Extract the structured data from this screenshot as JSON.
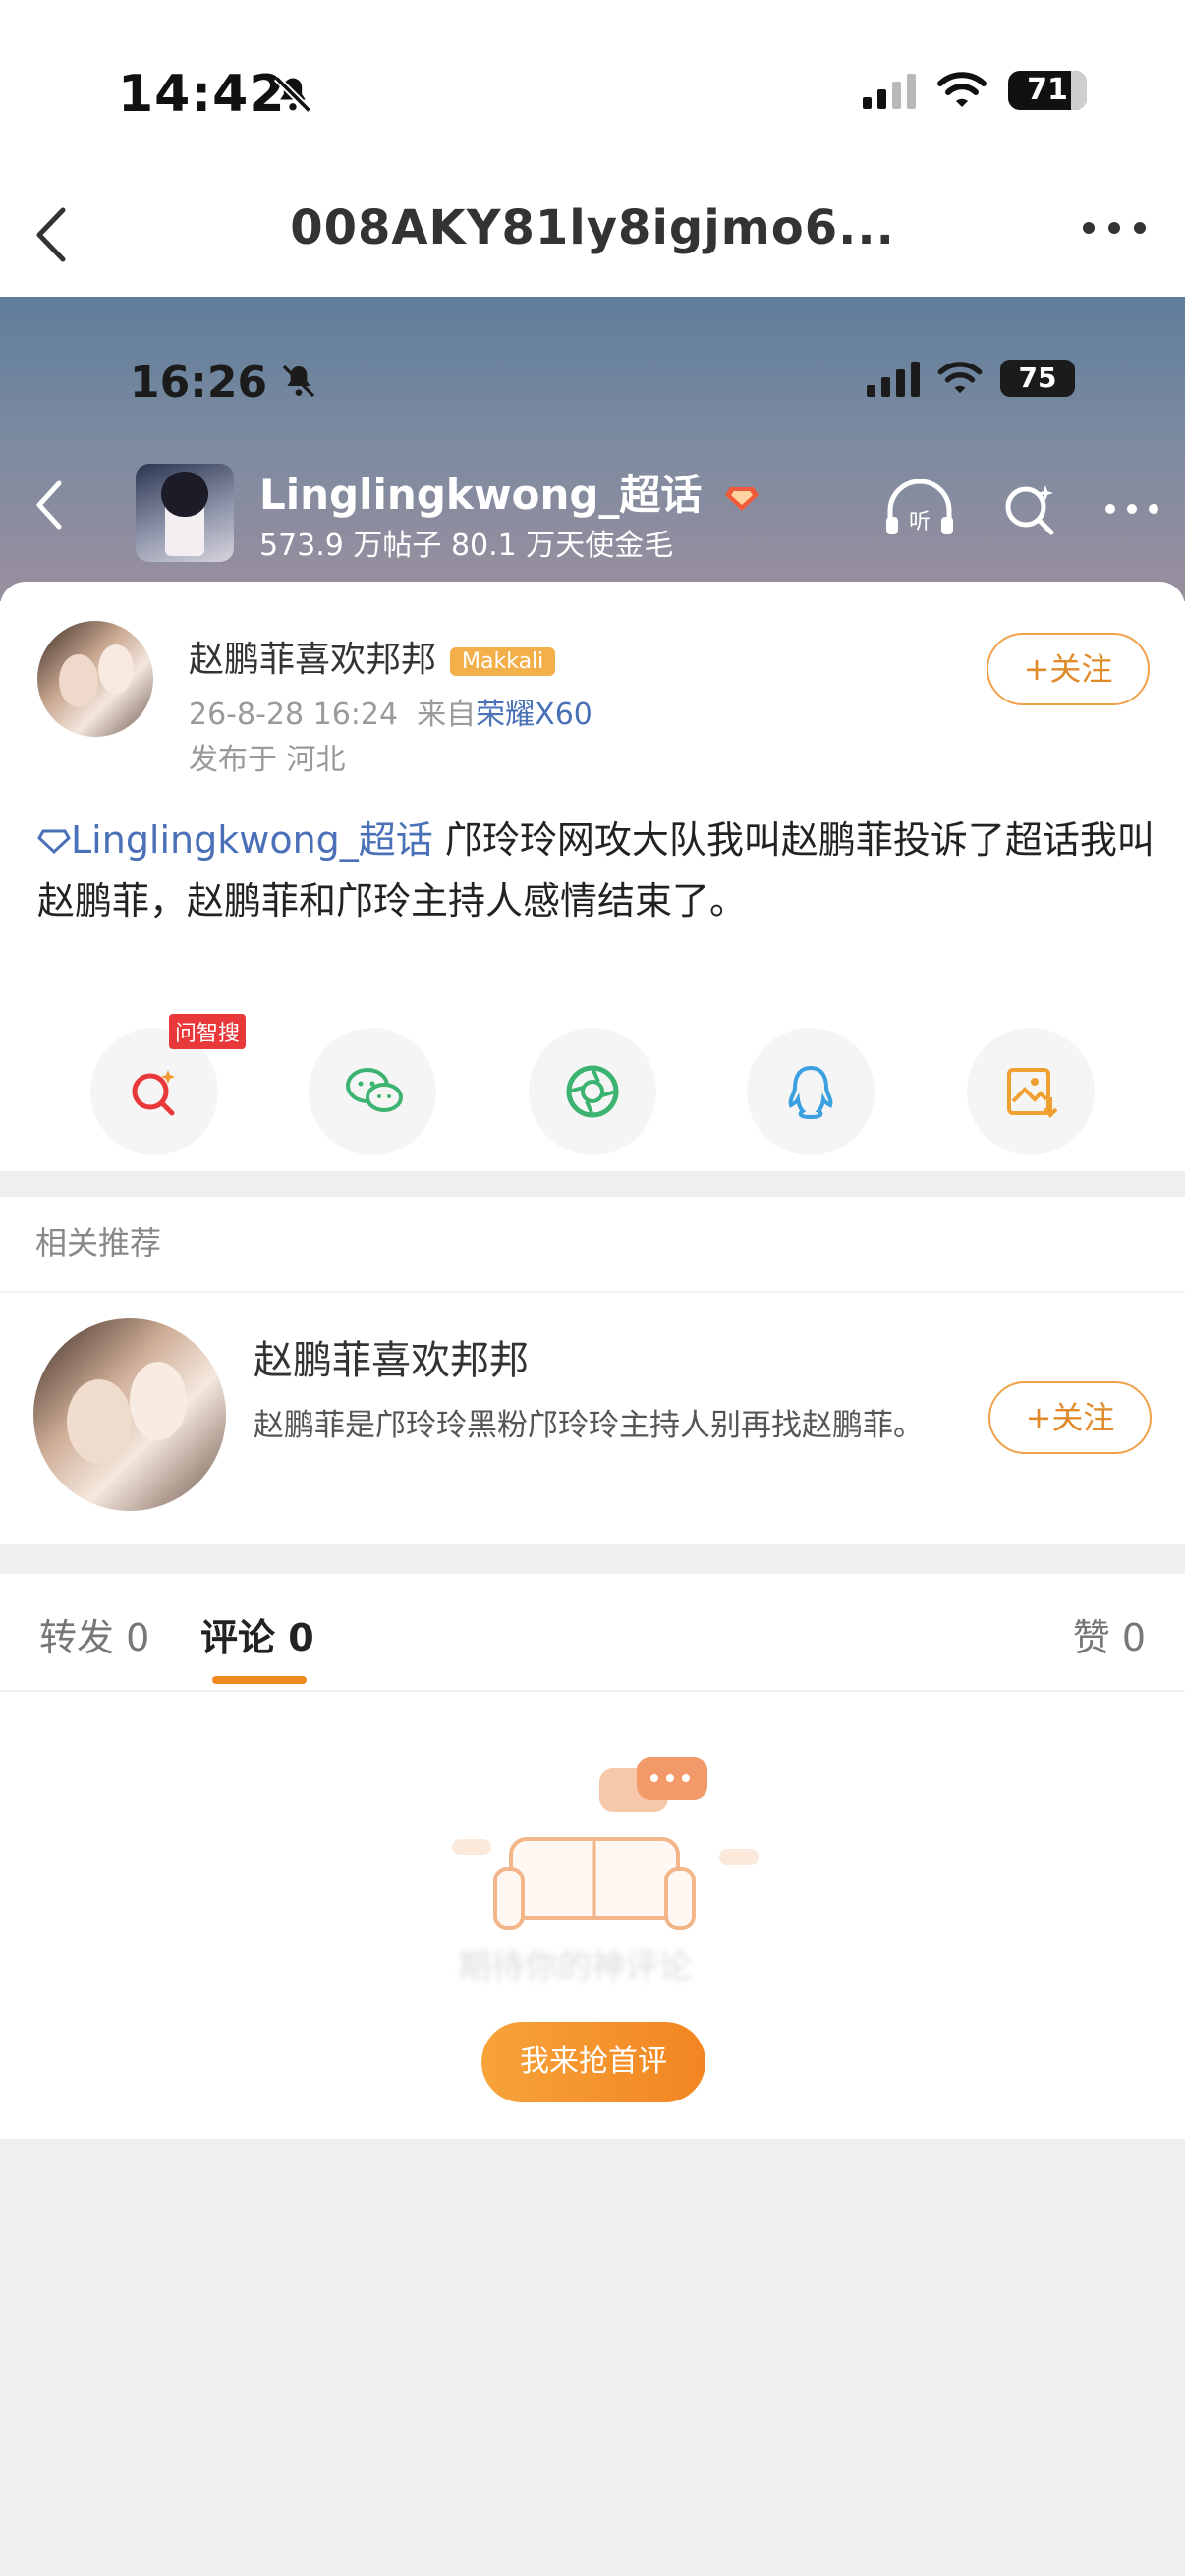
{
  "os_status": {
    "time": "14:42",
    "battery": "71"
  },
  "nav": {
    "title": "008AKY81ly8igjmo6..."
  },
  "inner": {
    "status": {
      "time": "16:26",
      "battery": "75"
    },
    "header": {
      "title": "Linglingkwong_超话",
      "stats": "573.9 万帖子 80.1 万天使金毛"
    },
    "post": {
      "author": "赵鹏菲喜欢邦邦",
      "author_tag": "Makkali",
      "time": "26-8-28 16:24",
      "source_prefix": "来自",
      "source": "荣耀X60",
      "location": "发布于 河北",
      "follow_label": "+关注",
      "topic": "Linglingkwong_超话",
      "text": " 邝玲玲网攻大队我叫赵鹏菲投诉了超话我叫赵鹏菲，赵鹏菲和邝玲主持人感情结束了。",
      "share_tag": "问智搜"
    },
    "recommend": {
      "heading": "相关推荐",
      "name": "赵鹏菲喜欢邦邦",
      "desc": "赵鹏菲是邝玲玲黑粉邝玲玲主持人别再找赵鹏菲。",
      "follow_label": "+关注"
    },
    "tabs": {
      "repost": "转发 0",
      "comment": "评论 0",
      "like": "赞 0"
    },
    "empty": {
      "text": "期待你的神评论",
      "button": "我来抢首评"
    }
  },
  "icons": {
    "os_bell": "bell-slash-icon",
    "nav_back": "chevron-left-icon",
    "nav_more": "more-horizontal-icon",
    "listen": "listen-headphones-icon",
    "search": "search-sparkle-icon",
    "wechat": "wechat-icon",
    "moments": "moments-icon",
    "qq": "qq-icon",
    "save_image": "save-image-icon"
  },
  "colors": {
    "accent": "#f0891e",
    "link": "#4a70b8",
    "tag_red": "#e8383a"
  }
}
